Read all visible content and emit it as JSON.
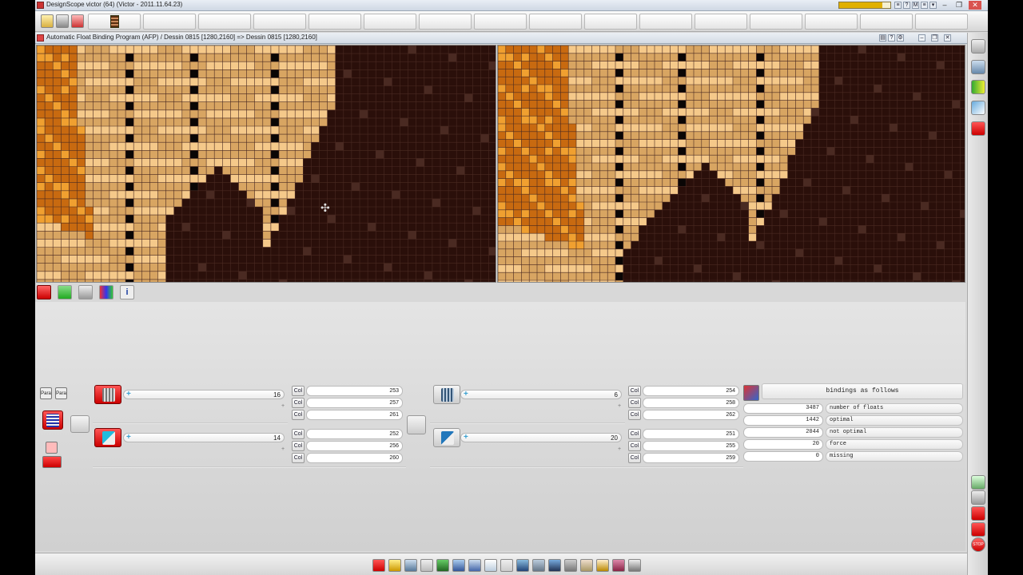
{
  "window": {
    "title": "DesignScope victor (64) (Victor - 2011.11.64.23)",
    "memory_fill_percent": 85,
    "title_buttons": [
      "≡",
      "?",
      "M",
      "≡",
      "▾"
    ],
    "controls": [
      "–",
      "❐",
      "✕"
    ]
  },
  "toolbar": {
    "icons": [
      "open-icon",
      "save-icon",
      "scissors-icon"
    ],
    "slot_count": 16,
    "active_slot": 0
  },
  "subwindow": {
    "title": "Automatic Float Binding Program (AFP)  / Dessin 0815 [1280,2160] => Dessin 0815 [1280,2160]",
    "buttons": [
      "▤",
      "?",
      "⚙",
      "–",
      "❐",
      "✕"
    ]
  },
  "lower_tabs": [
    {
      "icon": "design-view-icon",
      "glyph": ""
    },
    {
      "icon": "pencil-icon",
      "glyph": ""
    },
    {
      "icon": "binding-icon",
      "glyph": ""
    },
    {
      "icon": "color-table-icon",
      "glyph": ""
    },
    {
      "icon": "info-icon",
      "glyph": "i"
    }
  ],
  "panel": {
    "para_label_1": "Para",
    "para_label_2": "Para",
    "left_groups": [
      {
        "icon": "binding-red-icon",
        "value": "16",
        "small": "+",
        "cols": [
          {
            "label": "Col",
            "value": "253"
          },
          {
            "label": "Col",
            "value": "257"
          },
          {
            "label": "Col",
            "value": "261"
          }
        ]
      },
      {
        "icon": "pen-red-icon",
        "value": "14",
        "small": "+",
        "cols": [
          {
            "label": "Col",
            "value": "252"
          },
          {
            "label": "Col",
            "value": "256"
          },
          {
            "label": "Col",
            "value": "260"
          }
        ]
      }
    ],
    "right_groups": [
      {
        "icon": "binding-grey-icon",
        "value": "6",
        "small": "+",
        "cols": [
          {
            "label": "Col",
            "value": "254"
          },
          {
            "label": "Col",
            "value": "258"
          },
          {
            "label": "Col",
            "value": "262"
          }
        ]
      },
      {
        "icon": "pen-grey-icon",
        "value": "20",
        "small": "+",
        "cols": [
          {
            "label": "Col",
            "value": "251"
          },
          {
            "label": "Col",
            "value": "255"
          },
          {
            "label": "Col",
            "value": "259"
          }
        ]
      }
    ],
    "bindings": {
      "header": "bindings as follows",
      "rows": [
        {
          "value": "3487",
          "label": "number of floats"
        },
        {
          "value": "1442",
          "label": "optimal"
        },
        {
          "value": "2044",
          "label": "not optimal"
        },
        {
          "value": "20",
          "label": "force"
        },
        {
          "value": "0",
          "label": "missing"
        }
      ]
    }
  },
  "right_sidebar": {
    "stop_label": "STOP"
  },
  "colors": {
    "grid_bg": "#2a0f0a",
    "grid_line": "#4a2a22",
    "beige": "#d8a562",
    "light_beige": "#f5c98a",
    "orange": "#c86a10",
    "bright_orange": "#f0a030",
    "black": "#0a0605"
  }
}
